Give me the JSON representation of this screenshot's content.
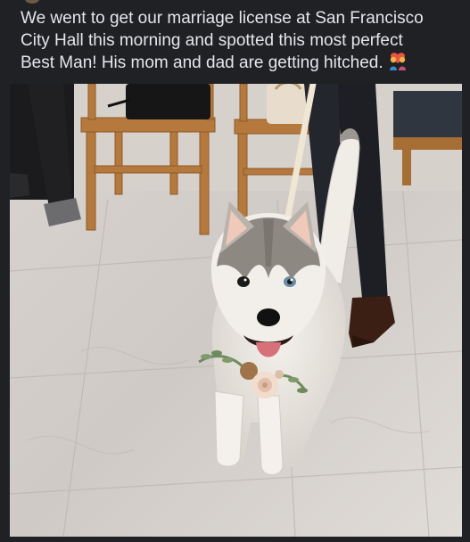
{
  "post": {
    "text_line_1": "We went to get our marriage license at San Francisco",
    "text_line_2": "City Hall this morning and spotted this most perfect",
    "text_line_3": "Best Man!  His mom and dad are getting hitched.",
    "emoji": "couple-with-heart-icon"
  },
  "photo": {
    "subject": "husky-puppy-with-floral-collar"
  }
}
